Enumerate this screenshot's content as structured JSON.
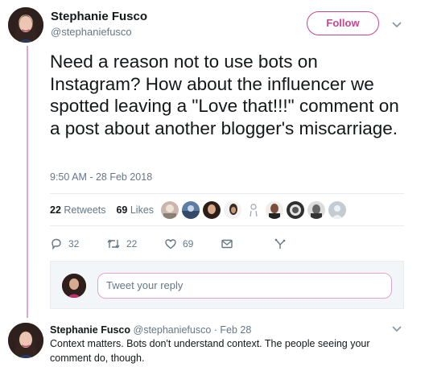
{
  "tweet": {
    "author_name": "Stephanie Fusco",
    "author_handle": "@stephaniefusco",
    "follow_label": "Follow",
    "text": "Need a reason not to use bots on Instagram? How about the influencer we spotted leaving a \"Love that!!!\" comment on a post about another blogger's miscarriage.",
    "timestamp": "9:50 AM - 28 Feb 2018"
  },
  "stats": {
    "retweets_count": "22",
    "retweets_label": "Retweets",
    "likes_count": "69",
    "likes_label": "Likes"
  },
  "actions": {
    "reply_count": "32",
    "retweet_count": "22",
    "like_count": "69"
  },
  "reply_box": {
    "placeholder": "Tweet your reply"
  },
  "reply": {
    "author_name": "Stephanie Fusco",
    "author_handle": "@stephaniefusco",
    "separator": " · ",
    "date": "Feb 28",
    "text": "Context matters. Bots don't understand context. The people seeing your comment do, though."
  },
  "colors": {
    "accent": "#c6468f",
    "thread_line": "#e0a6cf",
    "muted_text": "#657786"
  },
  "icons": [
    "chevron-down-icon",
    "reply-icon",
    "retweet-icon",
    "heart-icon",
    "message-icon",
    "analytics-icon"
  ]
}
